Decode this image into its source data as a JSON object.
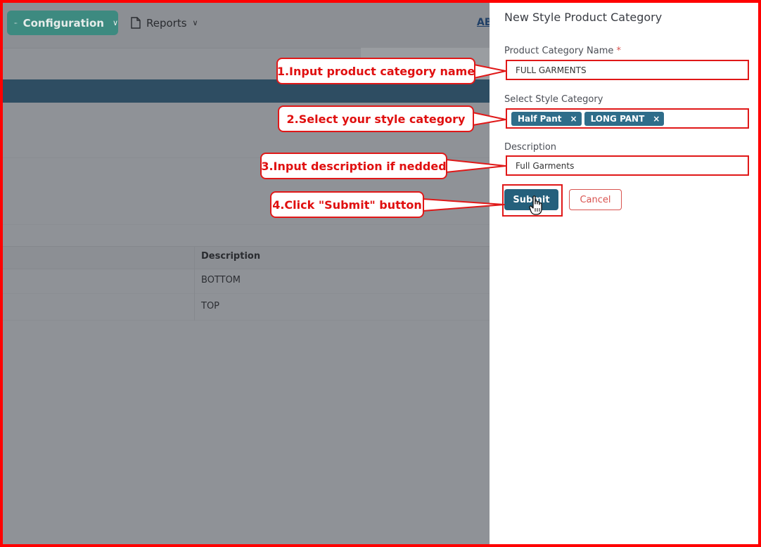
{
  "topbar": {
    "configuration_label": "Configuration",
    "reports_label": "Reports",
    "ab_link": "AB"
  },
  "table": {
    "header_description": "Description",
    "rows": [
      "BOTTOM",
      "TOP"
    ]
  },
  "panel": {
    "title": "New Style Product Category",
    "name_label": "Product Category Name",
    "name_required": "*",
    "name_value": "FULL GARMENTS",
    "style_label": "Select Style Category",
    "tags": [
      {
        "label": "Half Pant",
        "remove": "×"
      },
      {
        "label": "LONG PANT",
        "remove": "×"
      }
    ],
    "desc_label": "Description",
    "desc_value": "Full Garments",
    "submit_label": "Submit",
    "cancel_label": "Cancel"
  },
  "callouts": {
    "step1": "1.Input product category name",
    "step2": "2.Select your style category",
    "step3": "3.Input description if nedded",
    "step4": "4.Click \"Submit\" button"
  },
  "colors": {
    "annotation_red": "#e01818",
    "primary_button": "#25607c",
    "tag_bg": "#2f6d8a",
    "config_button": "#3d8a80",
    "overlay_dim": "#8f9297"
  },
  "icons": {
    "configuration": "dot-line-icon",
    "reports": "document-icon",
    "chevron": "chevron-down-icon",
    "cursor": "hand-pointer-icon"
  }
}
